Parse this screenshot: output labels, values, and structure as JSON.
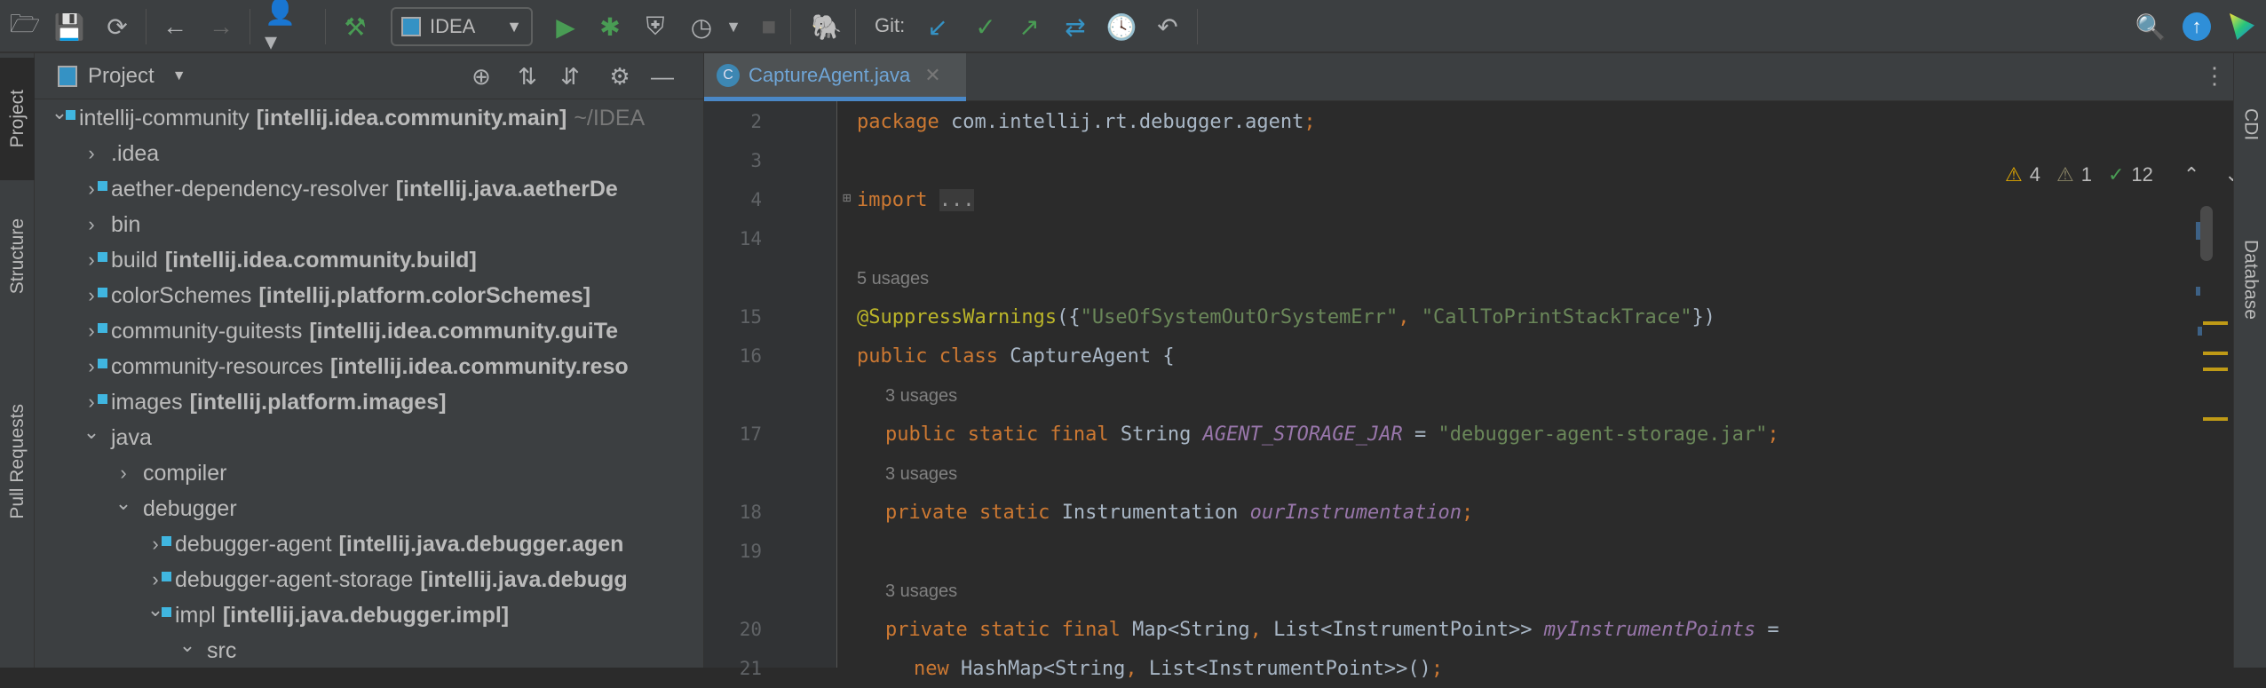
{
  "toolbar": {
    "run_config": "IDEA",
    "git_label": "Git:"
  },
  "left_stripe": {
    "tabs": [
      "Project",
      "Structure",
      "Pull Requests"
    ]
  },
  "right_stripe": {
    "tabs": [
      "CDI",
      "Database"
    ]
  },
  "project": {
    "title": "Project",
    "rows": [
      {
        "name": "intellij-community",
        "module": "[intellij.idea.community.main]",
        "suffix": "~/IDEA",
        "depth": 0,
        "expanded": true,
        "type": "module"
      },
      {
        "name": ".idea",
        "depth": 1,
        "expanded": false,
        "type": "folder"
      },
      {
        "name": "aether-dependency-resolver",
        "module": "[intellij.java.aetherDe",
        "depth": 1,
        "expanded": false,
        "type": "module"
      },
      {
        "name": "bin",
        "depth": 1,
        "expanded": false,
        "type": "folder"
      },
      {
        "name": "build",
        "module": "[intellij.idea.community.build]",
        "depth": 1,
        "expanded": false,
        "type": "module"
      },
      {
        "name": "colorSchemes",
        "module": "[intellij.platform.colorSchemes]",
        "depth": 1,
        "expanded": false,
        "type": "module"
      },
      {
        "name": "community-guitests",
        "module": "[intellij.idea.community.guiTe",
        "depth": 1,
        "expanded": false,
        "type": "module"
      },
      {
        "name": "community-resources",
        "module": "[intellij.idea.community.reso",
        "depth": 1,
        "expanded": false,
        "type": "module"
      },
      {
        "name": "images",
        "module": "[intellij.platform.images]",
        "depth": 1,
        "expanded": false,
        "type": "module"
      },
      {
        "name": "java",
        "depth": 1,
        "expanded": true,
        "type": "folder"
      },
      {
        "name": "compiler",
        "depth": 2,
        "expanded": false,
        "type": "folder"
      },
      {
        "name": "debugger",
        "depth": 2,
        "expanded": true,
        "type": "folder"
      },
      {
        "name": "debugger-agent",
        "module": "[intellij.java.debugger.agen",
        "depth": 3,
        "expanded": false,
        "type": "module"
      },
      {
        "name": "debugger-agent-storage",
        "module": "[intellij.java.debugg",
        "depth": 3,
        "expanded": false,
        "type": "module"
      },
      {
        "name": "impl",
        "module": "[intellij.java.debugger.impl]",
        "depth": 3,
        "expanded": true,
        "type": "module"
      },
      {
        "name": "src",
        "depth": 4,
        "expanded": true,
        "type": "src"
      }
    ]
  },
  "editor": {
    "tab": {
      "label": "CaptureAgent.java",
      "icon_letter": "C"
    },
    "inspections": {
      "warnings": "4",
      "weak_warnings": "1",
      "typos": "12"
    },
    "lines": [
      {
        "num": "2",
        "indent": 0,
        "tokens": [
          {
            "t": "package ",
            "c": "k"
          },
          {
            "t": "com.intellij.rt.debugger.agent",
            "c": "t"
          },
          {
            "t": ";",
            "c": "k"
          }
        ]
      },
      {
        "num": "3",
        "indent": 0,
        "tokens": []
      },
      {
        "num": "4",
        "indent": 0,
        "fold": true,
        "tokens": [
          {
            "t": "import ",
            "c": "k"
          },
          {
            "t": "...",
            "c": "fold"
          }
        ]
      },
      {
        "num": "14",
        "indent": 0,
        "tokens": []
      },
      {
        "num": "",
        "indent": 0,
        "usage": "5 usages"
      },
      {
        "num": "15",
        "indent": 0,
        "tokens": [
          {
            "t": "@SuppressWarnings",
            "c": "a"
          },
          {
            "t": "({",
            "c": "t"
          },
          {
            "t": "\"UseOfSystemOutOrSystemErr\"",
            "c": "s"
          },
          {
            "t": ", ",
            "c": "k"
          },
          {
            "t": "\"CallToPrintStackTrace\"",
            "c": "s"
          },
          {
            "t": "})",
            "c": "t"
          }
        ]
      },
      {
        "num": "16",
        "indent": 0,
        "tokens": [
          {
            "t": "public class ",
            "c": "k"
          },
          {
            "t": "CaptureAgent {",
            "c": "t"
          }
        ]
      },
      {
        "num": "",
        "indent": 1,
        "usage": "3 usages"
      },
      {
        "num": "17",
        "indent": 1,
        "tokens": [
          {
            "t": "public static final ",
            "c": "k"
          },
          {
            "t": "String ",
            "c": "t"
          },
          {
            "t": "AGENT_STORAGE_JAR",
            "c": "f"
          },
          {
            "t": " = ",
            "c": "t"
          },
          {
            "t": "\"debugger-agent-storage.jar\"",
            "c": "s"
          },
          {
            "t": ";",
            "c": "k"
          }
        ]
      },
      {
        "num": "",
        "indent": 1,
        "usage": "3 usages"
      },
      {
        "num": "18",
        "indent": 1,
        "tokens": [
          {
            "t": "private static ",
            "c": "k"
          },
          {
            "t": "Instrumentation ",
            "c": "t"
          },
          {
            "t": "ourInstrumentation",
            "c": "f"
          },
          {
            "t": ";",
            "c": "k"
          }
        ]
      },
      {
        "num": "19",
        "indent": 0,
        "tokens": []
      },
      {
        "num": "",
        "indent": 1,
        "usage": "3 usages"
      },
      {
        "num": "20",
        "indent": 1,
        "tokens": [
          {
            "t": "private static final ",
            "c": "k"
          },
          {
            "t": "Map<String",
            "c": "t"
          },
          {
            "t": ", ",
            "c": "k"
          },
          {
            "t": "List<InstrumentPoint>> ",
            "c": "t"
          },
          {
            "t": "myInstrumentPoints",
            "c": "f"
          },
          {
            "t": " =",
            "c": "t"
          }
        ]
      },
      {
        "num": "21",
        "indent": 2,
        "tokens": [
          {
            "t": "new ",
            "c": "k"
          },
          {
            "t": "HashMap<String",
            "c": "t"
          },
          {
            "t": ", ",
            "c": "k"
          },
          {
            "t": "List<InstrumentPoint>>()",
            "c": "t"
          },
          {
            "t": ";",
            "c": "k"
          }
        ]
      }
    ]
  },
  "colors": {
    "keyword": "#cc7832",
    "string": "#6a8759",
    "annotation": "#bbb529",
    "field": "#9876aa",
    "accent": "#4a88c7"
  }
}
